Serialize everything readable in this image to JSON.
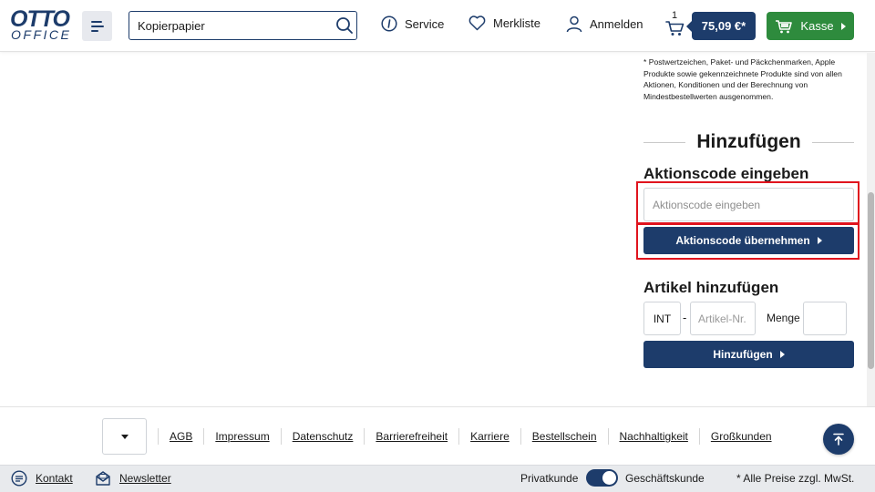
{
  "header": {
    "logo_top": "OTTO",
    "logo_bottom": "OFFICE",
    "search_value": "Kopierpapier",
    "service_label": "Service",
    "wishlist_label": "Merkliste",
    "login_label": "Anmelden",
    "cart_count": "1",
    "cart_total": "75,09 €*",
    "checkout_label": "Kasse"
  },
  "sidebar": {
    "disclaimer": "* Postwertzeichen, Paket- und Päckchenmarken, Apple Produkte sowie gekennzeichnete Produkte sind von allen Aktionen, Konditionen und der Berechnung von Mindestbestellwerten ausgenommen.",
    "section_title": "Hinzufügen",
    "promo": {
      "heading": "Aktionscode eingeben",
      "placeholder": "Aktionscode eingeben",
      "button_label": "Aktionscode übernehmen"
    },
    "article": {
      "heading": "Artikel hinzufügen",
      "prefix": "INT",
      "dash": "-",
      "number_placeholder": "Artikel-Nr.",
      "quantity_label": "Menge",
      "button_label": "Hinzufügen"
    }
  },
  "footer": {
    "links": [
      "AGB",
      "Impressum",
      "Datenschutz",
      "Barrierefreiheit",
      "Karriere",
      "Bestellschein",
      "Nachhaltigkeit",
      "Großkunden"
    ],
    "contact_label": "Kontakt",
    "newsletter_label": "Newsletter",
    "toggle_left": "Privatkunde",
    "toggle_right": "Geschäftskunde",
    "vat_note": "* Alle Preise zzgl. MwSt."
  },
  "colors": {
    "brand_navy": "#1d3c6b",
    "checkout_green": "#2e8b3d",
    "highlight_red": "#e0141e"
  }
}
